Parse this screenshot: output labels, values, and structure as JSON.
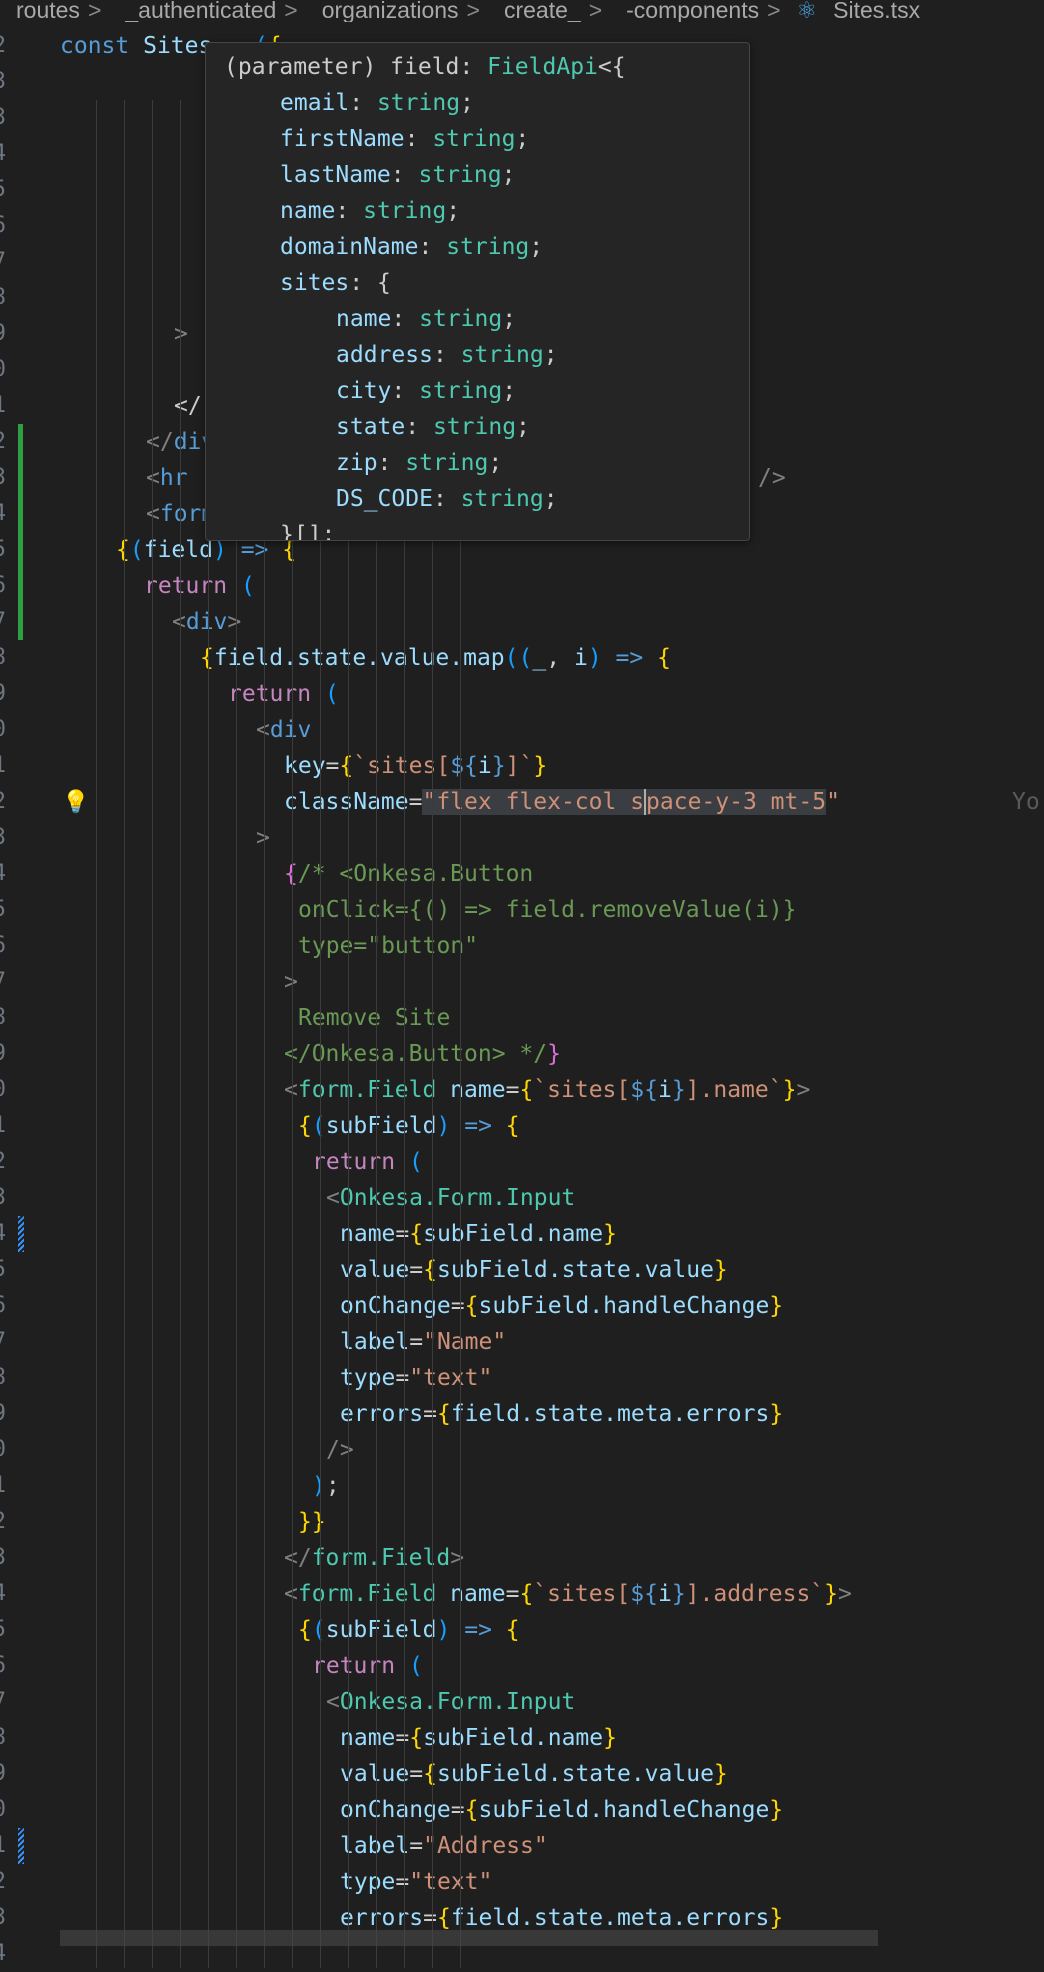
{
  "breadcrumb": {
    "items": [
      "routes",
      "_authenticated",
      "organizations",
      "create_",
      "-components",
      "Sites.tsx"
    ],
    "separator": ">"
  },
  "editor": {
    "line_numbers": [
      "2",
      "3",
      "3",
      "4",
      "5",
      "6",
      "7",
      "8",
      "9",
      "0",
      "1",
      "2",
      "3",
      "4",
      "5",
      "6",
      "7",
      "8",
      "9",
      "0",
      "1",
      "2",
      "3",
      "4",
      "5",
      "6",
      "7",
      "8",
      "9",
      "0",
      "1",
      "2",
      "3",
      "4",
      "5",
      "6",
      "7",
      "8",
      "9",
      "0",
      "1",
      "2",
      "3",
      "4",
      "5",
      "6",
      "7",
      "8",
      "9",
      "0",
      "1",
      "2",
      "3",
      "4"
    ],
    "top_line": "const Sites = ({",
    "partial_lines": [
      ">",
      "</",
      "</div>",
      "<hr",
      "<form"
    ],
    "partial_line_tail": "/>",
    "code_lines": [
      "{(field) => {",
      "return (",
      "<div>",
      "{field.state.value.map((_, i) => {",
      "return (",
      "<div",
      "key={`sites[${i}]`}",
      "className=\"flex flex-col space-y-3 mt-5\"",
      ">",
      "{/* <Onkesa.Button",
      "onClick={() => field.removeValue(i)}",
      "type=\"button\"",
      ">",
      "Remove Site",
      "</Onkesa.Button> */}",
      "<form.Field name={`sites[${i}].name`}>",
      "{(subField) => {",
      "return (",
      "<Onkesa.Form.Input",
      "name={subField.name}",
      "value={subField.state.value}",
      "onChange={subField.handleChange}",
      "label=\"Name\"",
      "type=\"text\"",
      "errors={field.state.meta.errors}",
      "/>",
      ");",
      "}}",
      "</form.Field>",
      "<form.Field name={`sites[${i}].address`}>",
      "{(subField) => {",
      "return (",
      "<Onkesa.Form.Input",
      "name={subField.name}",
      "value={subField.state.value}",
      "onChange={subField.handleChange}",
      "label=\"Address\"",
      "type=\"text\"",
      "errors={field.state.meta.errors}"
    ],
    "ghost_text": "Yo",
    "lightbulb_icon": "lightbulb-icon"
  },
  "hover": {
    "lines": [
      "(parameter) field: FieldApi<{",
      "email: string;",
      "firstName: string;",
      "lastName: string;",
      "name: string;",
      "domainName: string;",
      "sites: {",
      "name: string;",
      "address: string;",
      "city: string;",
      "state: string;",
      "zip: string;",
      "DS_CODE: string;",
      "}[];"
    ]
  },
  "colors": {
    "background": "#1f1f1f",
    "keyword": "#569cd6",
    "string": "#ce9178",
    "added_gutter": "#2ea043",
    "modified_gutter": "#3794ff"
  }
}
